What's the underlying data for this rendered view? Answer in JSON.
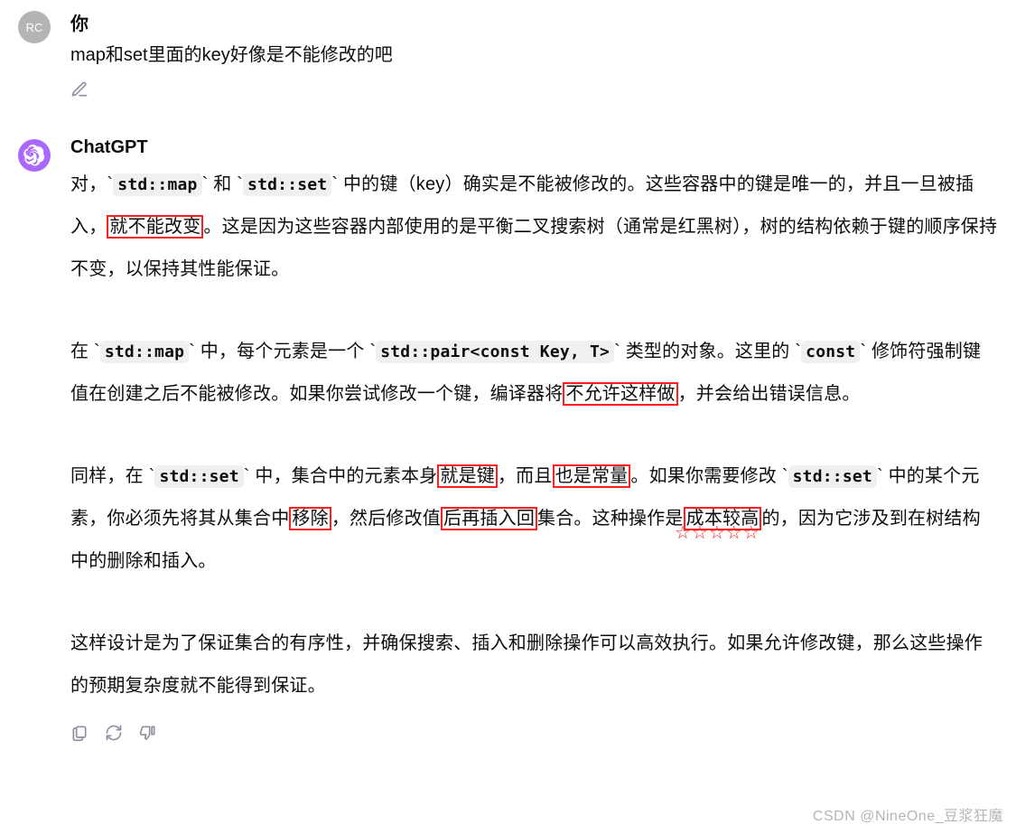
{
  "user": {
    "avatar_text": "RC",
    "name": "你",
    "message": "map和set里面的key好像是不能修改的吧"
  },
  "bot": {
    "name": "ChatGPT",
    "p1_a": "对，",
    "p1_code1": "std::map",
    "p1_b": " 和 ",
    "p1_code2": "std::set",
    "p1_c": " 中的键（key）确实是不能被修改的。这些容器中的键是唯一的，并且一旦被插入，",
    "p1_hl1": "就不能改变",
    "p1_d": "。这是因为这些容器内部使用的是平衡二叉搜索树（通常是红黑树），树的结构依赖于键的顺序保持不变，以保持其性能保证。",
    "p2_a": "在 ",
    "p2_code1": "std::map",
    "p2_b": " 中，每个元素是一个 ",
    "p2_code2": "std::pair<const Key, T>",
    "p2_c": " 类型的对象。这里的 ",
    "p2_code3": "const",
    "p2_d": " 修饰符强制键值在创建之后不能被修改。如果你尝试修改一个键，编译器将",
    "p2_hl1": "不允许这样做",
    "p2_e": "，并会给出错误信息。",
    "p3_a": "同样，在 ",
    "p3_code1": "std::set",
    "p3_b": " 中，集合中的元素本身",
    "p3_hl1": "就是键",
    "p3_c": "，而且",
    "p3_hl2": "也是常量",
    "p3_d": "。如果你需要修改 ",
    "p3_code2": "std::set",
    "p3_e": " 中的某个元素，你必须先将其从集合中",
    "p3_hl3": "移除",
    "p3_f": "，然后修改值",
    "p3_hl4": "后再插入回",
    "p3_g": "集合。这种操作是",
    "p3_hl5": "成本较高",
    "p3_h": "的，因为它涉及到在树结构中的删除和插入。",
    "p4": "这样设计是为了保证集合的有序性，并确保搜索、插入和删除操作可以高效执行。如果允许修改键，那么这些操作的预期复杂度就不能得到保证。"
  },
  "annotation": {
    "stars": "☆☆☆☆☆"
  },
  "watermark": "CSDN @NineOne_豆浆狂魔"
}
